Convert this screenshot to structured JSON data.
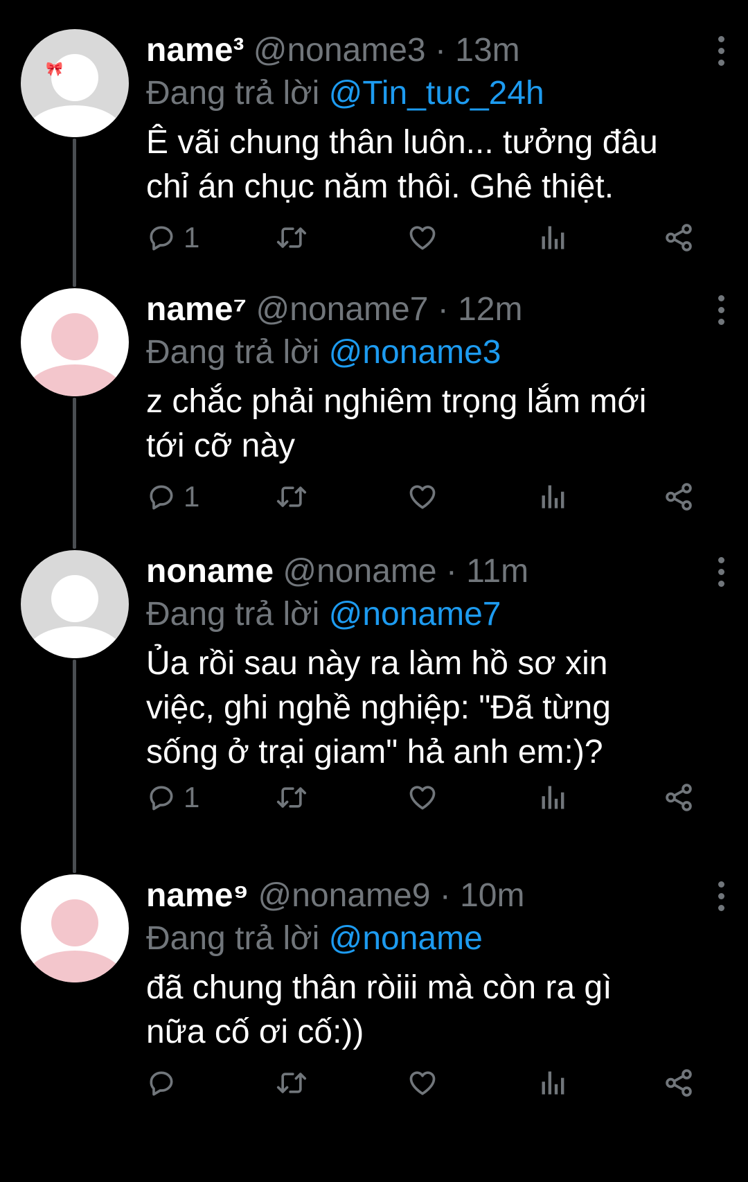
{
  "colors": {
    "background": "#000000",
    "text": "#ffffff",
    "muted": "#71767b",
    "mention": "#1d9bf0",
    "thread_line": "#4a4e52"
  },
  "icons": {
    "reply": "reply-bubble-icon",
    "retweet": "retweet-icon",
    "like": "heart-icon",
    "views": "bar-chart-icon",
    "share": "share-icon",
    "more": "more-vertical-icon"
  },
  "tweets": [
    {
      "display_name": "name³",
      "handle": "@noname3",
      "separator": "·",
      "time": "13m",
      "reply_prefix": "Đang trả lời",
      "reply_to": "@Tin_tuc_24h",
      "text_lines": [
        "Ê vãi chung thân luôn... tưởng đâu",
        "chỉ án chục năm thôi. Ghê thiệt."
      ],
      "reply_count": "1",
      "avatar": "bow"
    },
    {
      "display_name": "name⁷",
      "handle": "@noname7",
      "separator": "·",
      "time": "12m",
      "reply_prefix": "Đang trả lời",
      "reply_to": "@noname3",
      "text_lines": [
        "z chắc phải nghiêm trọng lắm mới",
        "tới cỡ này"
      ],
      "reply_count": "1",
      "avatar": "pink"
    },
    {
      "display_name": "noname",
      "handle": "@noname",
      "separator": "·",
      "time": "11m",
      "reply_prefix": "Đang trả lời",
      "reply_to": "@noname7",
      "text_lines": [
        "Ủa rồi sau này ra làm hồ sơ xin",
        "việc, ghi nghề nghiệp: \"Đã từng",
        "sống ở trại giam\" hả anh em:)?"
      ],
      "reply_count": "1",
      "avatar": "grey"
    },
    {
      "display_name": "name⁹",
      "handle": "@noname9",
      "separator": "·",
      "time": "10m",
      "reply_prefix": "Đang trả lời",
      "reply_to": "@noname",
      "text_lines": [
        "đã chung thân ròiii mà còn ra gì",
        "nữa cố ơi cố:))"
      ],
      "reply_count": "",
      "avatar": "pink"
    }
  ]
}
